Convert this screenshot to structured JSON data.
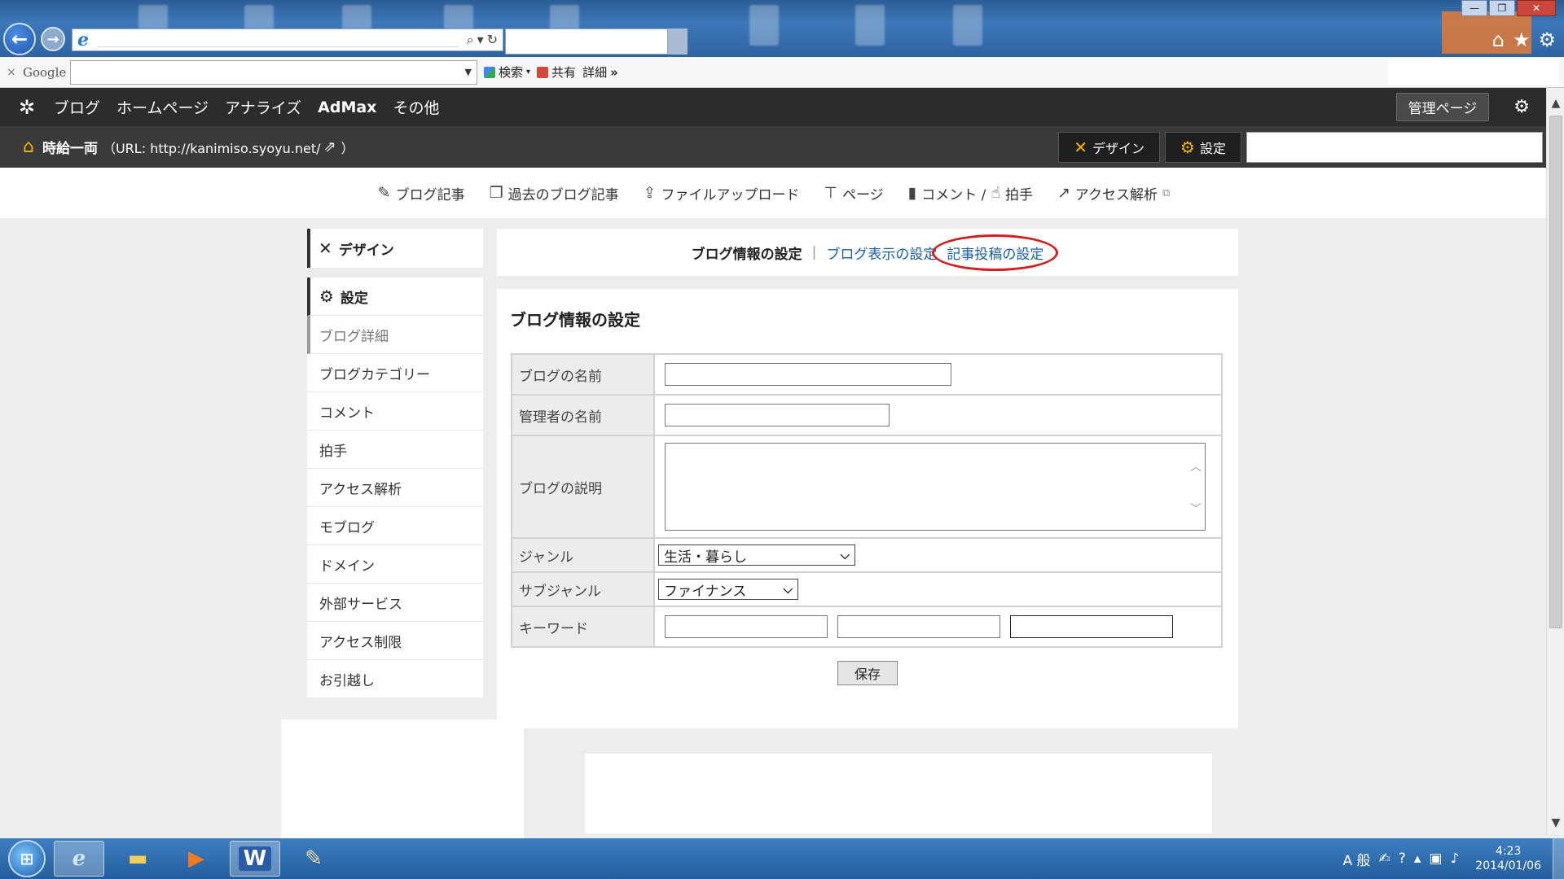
{
  "browser": {
    "back_icon": "←",
    "forward_icon": "→",
    "ie_logo": "e",
    "tools": [
      "⌂",
      "★",
      "⚙"
    ],
    "window_controls": [
      "—",
      "❐",
      "✕"
    ]
  },
  "google_toolbar": {
    "close": "×",
    "logo": "Google",
    "search_label": "検索",
    "share_label": "共有",
    "details_label": "詳細",
    "more": "»"
  },
  "site_nav": {
    "logo": "✲",
    "items": [
      "ブログ",
      "ホームページ",
      "アナライズ",
      "AdMax",
      "その他"
    ],
    "admin_button": "管理ページ",
    "gear": "⚙"
  },
  "blog_bar": {
    "name": "時給一両",
    "url_text": "（URL: http://kanimiso.syoyu.net/",
    "url_close": "）",
    "design_button": "デザイン",
    "settings_button": "設定"
  },
  "sub_menu": [
    {
      "icon": "✎",
      "label": "ブログ記事"
    },
    {
      "icon": "❐",
      "label": "過去のブログ記事"
    },
    {
      "icon": "⇪",
      "label": "ファイルアップロード"
    },
    {
      "icon": "⊤",
      "label": "ページ"
    },
    {
      "icon": "▮",
      "label": "コメント /"
    },
    {
      "icon": "☝",
      "label": "拍手"
    },
    {
      "icon": "↗",
      "label": "アクセス解析"
    }
  ],
  "sidebar": {
    "design": "デザイン",
    "settings": "設定",
    "items": [
      "ブログ詳細",
      "ブログカテゴリー",
      "コメント",
      "拍手",
      "アクセス解析",
      "モブログ",
      "ドメイン",
      "外部サービス",
      "アクセス制限",
      "お引越し"
    ]
  },
  "tabs": {
    "current": "ブログ情報の設定",
    "separator": "|",
    "display": "ブログ表示の設定",
    "post": "記事投稿の設定"
  },
  "form": {
    "title": "ブログ情報の設定",
    "labels": {
      "blog_name": "ブログの名前",
      "admin_name": "管理者の名前",
      "description": "ブログの説明",
      "genre": "ジャンル",
      "subgenre": "サブジャンル",
      "keywords": "キーワード"
    },
    "values": {
      "blog_name": "",
      "admin_name": "",
      "description": "",
      "genre": "生活・暮らし",
      "subgenre": "ファイナンス",
      "keywords": [
        "",
        "",
        ""
      ]
    },
    "save_button": "保存"
  },
  "taskbar": {
    "ime": "A 般",
    "time": "4:23",
    "date": "2014/01/06"
  }
}
